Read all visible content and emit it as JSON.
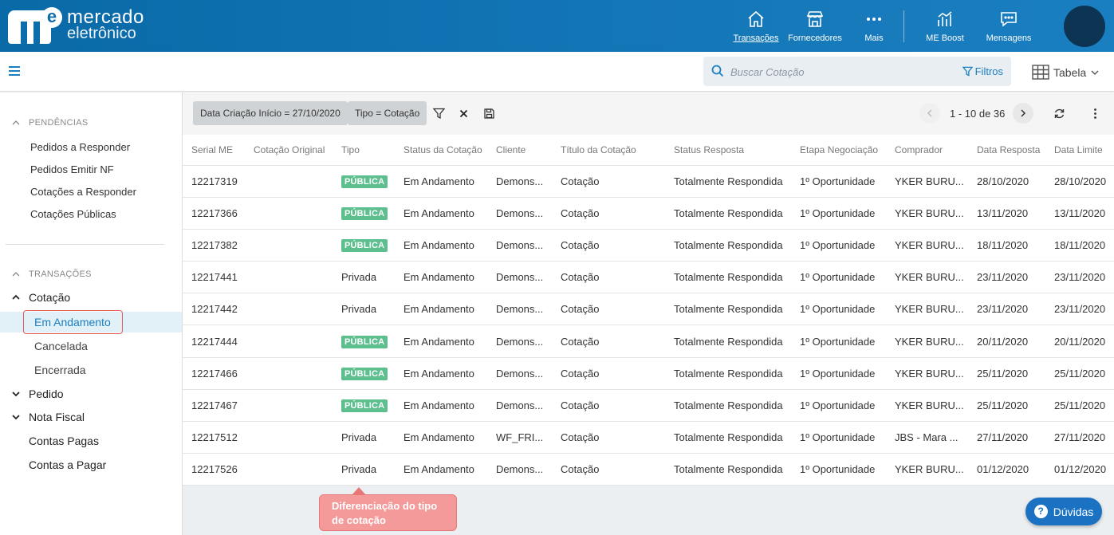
{
  "logo": {
    "line1": "mercado",
    "line2": "eletrônico",
    "mark_letter": "e"
  },
  "nav": [
    {
      "label": "Transações",
      "icon": "home-icon",
      "active": true
    },
    {
      "label": "Fornecedores",
      "icon": "store-icon"
    },
    {
      "label": "Mais",
      "icon": "more-dots-icon"
    },
    {
      "label": "ME Boost",
      "icon": "chart-icon"
    },
    {
      "label": "Mensagens",
      "icon": "message-icon"
    }
  ],
  "search": {
    "placeholder": "Buscar Cotação",
    "filters_label": "Filtros"
  },
  "view_selector": {
    "label": "Tabela"
  },
  "sidebar": {
    "pendencias_title": "PENDÊNCIAS",
    "pendencias": [
      "Pedidos a Responder",
      "Pedidos Emitir NF",
      "Cotações a Responder",
      "Cotações Públicas"
    ],
    "transacoes_title": "TRANSAÇÕES",
    "cotacao_label": "Cotação",
    "cotacao_items": [
      "Em Andamento",
      "Cancelada",
      "Encerrada"
    ],
    "pedido_label": "Pedido",
    "nota_fiscal_label": "Nota Fiscal",
    "contas_pagas_label": "Contas Pagas",
    "contas_pagar_label": "Contas a Pagar"
  },
  "toolbar": {
    "chips": [
      "Data Criação Início = 27/10/2020",
      "Tipo = Cotação"
    ],
    "pagination": "1 - 10 de 36"
  },
  "table": {
    "columns": [
      "Serial ME",
      "Cotação Original",
      "Tipo",
      "Status da Cotação",
      "Cliente",
      "Título da Cotação",
      "Status Resposta",
      "Etapa Negociação",
      "Comprador",
      "Data Resposta",
      "Data Limite"
    ],
    "rows": [
      [
        "12217319",
        "",
        "PÚBLICA",
        "Em Andamento",
        "Demons...",
        "Cotação",
        "Totalmente Respondida",
        "1º Oportunidade",
        "YKER BURU...",
        "28/10/2020",
        "28/10/2020"
      ],
      [
        "12217366",
        "",
        "PÚBLICA",
        "Em Andamento",
        "Demons...",
        "Cotação",
        "Totalmente Respondida",
        "1º Oportunidade",
        "YKER BURU...",
        "13/11/2020",
        "13/11/2020"
      ],
      [
        "12217382",
        "",
        "PÚBLICA",
        "Em Andamento",
        "Demons...",
        "Cotação",
        "Totalmente Respondida",
        "1º Oportunidade",
        "YKER BURU...",
        "18/11/2020",
        "18/11/2020"
      ],
      [
        "12217441",
        "",
        "Privada",
        "Em Andamento",
        "Demons...",
        "Cotação",
        "Totalmente Respondida",
        "1º Oportunidade",
        "YKER BURU...",
        "23/11/2020",
        "23/11/2020"
      ],
      [
        "12217442",
        "",
        "Privada",
        "Em Andamento",
        "Demons...",
        "Cotação",
        "Totalmente Respondida",
        "1º Oportunidade",
        "YKER BURU...",
        "23/11/2020",
        "23/11/2020"
      ],
      [
        "12217444",
        "",
        "PÚBLICA",
        "Em Andamento",
        "Demons...",
        "Cotação",
        "Totalmente Respondida",
        "1º Oportunidade",
        "YKER BURU...",
        "20/11/2020",
        "20/11/2020"
      ],
      [
        "12217466",
        "",
        "PÚBLICA",
        "Em Andamento",
        "Demons...",
        "Cotação",
        "Totalmente Respondida",
        "1º Oportunidade",
        "YKER BURU...",
        "25/11/2020",
        "25/11/2020"
      ],
      [
        "12217467",
        "",
        "PÚBLICA",
        "Em Andamento",
        "Demons...",
        "Cotação",
        "Totalmente Respondida",
        "1º Oportunidade",
        "YKER BURU...",
        "25/11/2020",
        "25/11/2020"
      ],
      [
        "12217512",
        "",
        "Privada",
        "Em Andamento",
        "WF_FRI...",
        "Cotação",
        "Totalmente Respondida",
        "1º Oportunidade",
        "JBS - Mara ...",
        "27/11/2020",
        "27/11/2020"
      ],
      [
        "12217526",
        "",
        "Privada",
        "Em Andamento",
        "Demons...",
        "Cotação",
        "Totalmente Respondida",
        "1º Oportunidade",
        "YKER BURU...",
        "01/12/2020",
        "01/12/2020"
      ]
    ]
  },
  "callout": {
    "line1": "Diferenciação do tipo",
    "line2": "de cotação"
  },
  "help_button": {
    "label": "Dúvidas"
  },
  "colors": {
    "header": "#0c6dad",
    "accent": "#1a7fc1",
    "badge_public": "#5cbf8d",
    "callout": "#f59a9a"
  }
}
